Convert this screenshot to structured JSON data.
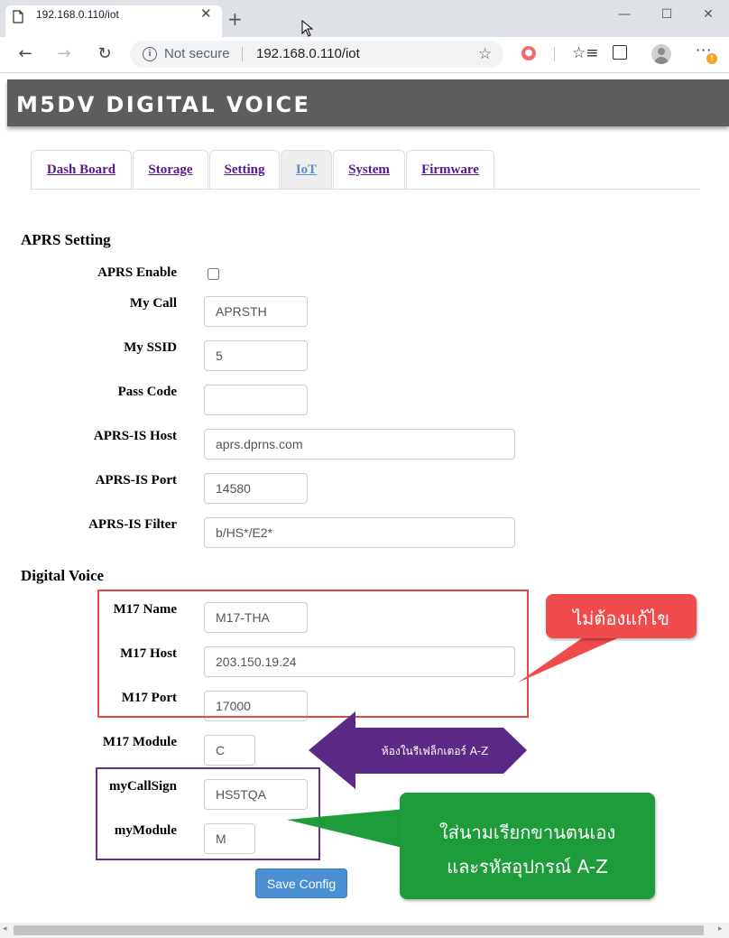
{
  "browser": {
    "tab_title": "192.168.0.110/iot",
    "tab_close": "✕",
    "new_tab": "+",
    "window_controls": {
      "minimize": "—",
      "maximize": "☐",
      "close": "✕"
    },
    "security_label": "Not secure",
    "url": "192.168.0.110/iot",
    "icons": [
      "page-icon",
      "back-icon",
      "forward-icon",
      "refresh-icon",
      "info-icon",
      "star-icon",
      "extension-icon",
      "favorites-icon",
      "collections-icon",
      "profile-icon",
      "menu-icon"
    ],
    "back": "←",
    "forward": "→",
    "refresh": "↻",
    "star": "☆",
    "favorites": "☆≡",
    "menu": "···",
    "update_badge": "!"
  },
  "app": {
    "title": "M5DV DIGITAL VOICE"
  },
  "tabs": [
    {
      "label": "Dash Board",
      "active": false
    },
    {
      "label": "Storage",
      "active": false
    },
    {
      "label": "Setting",
      "active": false
    },
    {
      "label": "IoT",
      "active": true
    },
    {
      "label": "System",
      "active": false
    },
    {
      "label": "Firmware",
      "active": false
    }
  ],
  "aprs": {
    "section_title": "APRS Setting",
    "enable_label": "APRS Enable",
    "enable_checked": false,
    "mycall_label": "My Call",
    "mycall_value": "APRSTH",
    "ssid_label": "My SSID",
    "ssid_value": "5",
    "passcode_label": "Pass Code",
    "passcode_value": "",
    "host_label": "APRS-IS Host",
    "host_value": "aprs.dprns.com",
    "port_label": "APRS-IS Port",
    "port_value": "14580",
    "filter_label": "APRS-IS Filter",
    "filter_value": "b/HS*/E2*"
  },
  "dv": {
    "section_title": "Digital Voice",
    "m17name_label": "M17 Name",
    "m17name_value": "M17-THA",
    "m17host_label": "M17 Host",
    "m17host_value": "203.150.19.24",
    "m17port_label": "M17 Port",
    "m17port_value": "17000",
    "m17module_label": "M17 Module",
    "m17module_value": "C",
    "mycallsign_label": "myCallSign",
    "mycallsign_value": "HS5TQA",
    "mymodule_label": "myModule",
    "mymodule_value": "M"
  },
  "save_button": "Save Config",
  "annotations": {
    "red_callout": "ไม่ต้องแก้ไข",
    "purple_arrow": "ห้องในรีเฟล็กเตอร์ A-Z",
    "green_line1": "ใส่นามเรียกขานตนเอง",
    "green_line2": "และรหัสอุปกรณ์ A-Z",
    "red_color": "#ef4b4b",
    "purple_color": "#5b2a86",
    "green_color": "#1f9c3a"
  },
  "scrollbar": {
    "left": "◂",
    "right": "▸"
  }
}
